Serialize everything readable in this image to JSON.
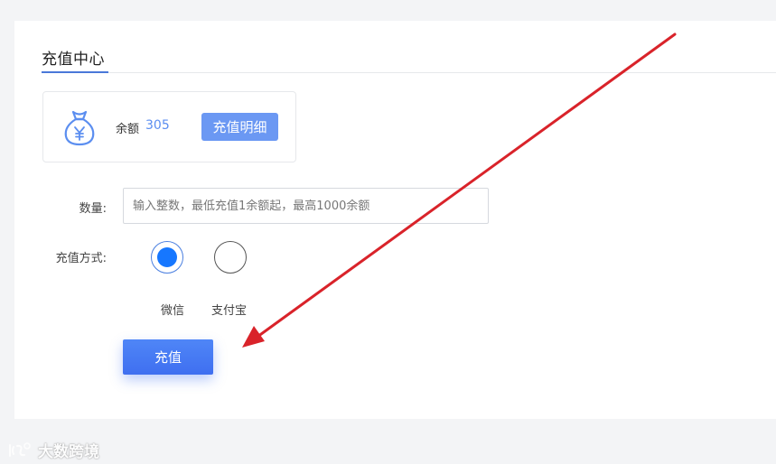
{
  "tab": {
    "title": "充值中心"
  },
  "balance": {
    "label": "余额",
    "value": "305",
    "detail_button": "充值明细",
    "icon": "moneybag-yen-icon"
  },
  "form": {
    "quantity_label": "数量:",
    "quantity_placeholder": "输入整数，最低充值1余额起，最高1000余额",
    "quantity_value": "",
    "method_label": "充值方式:",
    "methods": [
      {
        "label": "微信",
        "selected": true
      },
      {
        "label": "支付宝",
        "selected": false
      }
    ],
    "submit_label": "充值"
  },
  "colors": {
    "accent": "#4a78d9",
    "radio_selected": "#1677ff",
    "annotation_arrow": "#d9232a"
  },
  "watermark": {
    "text": "大数跨境"
  }
}
